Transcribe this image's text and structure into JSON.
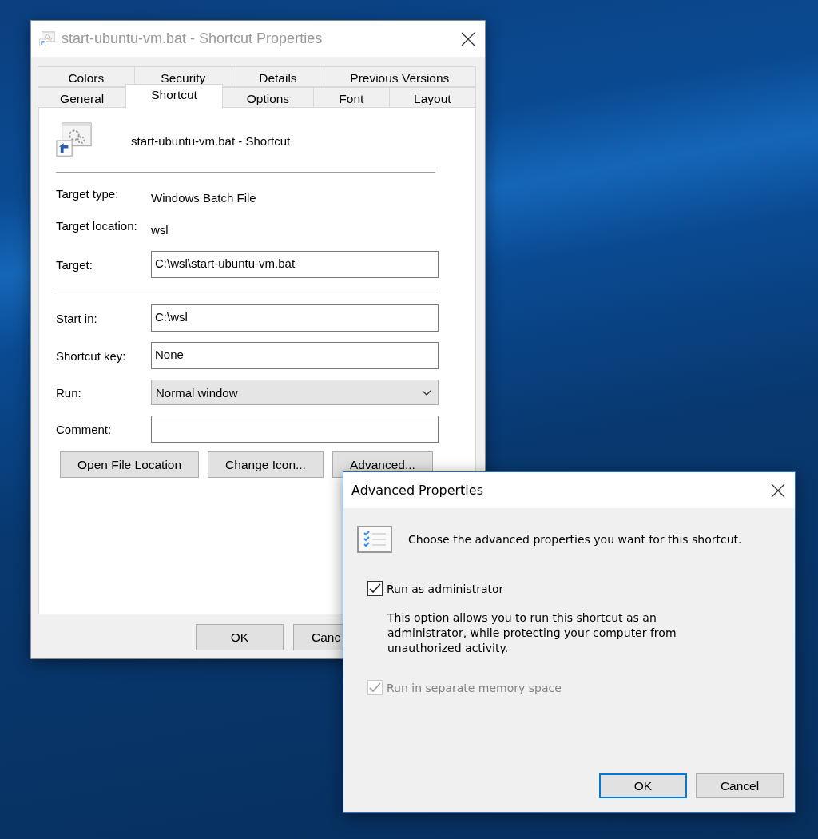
{
  "properties_window": {
    "title": "start-ubuntu-vm.bat - Shortcut Properties",
    "tab_rows": [
      [
        {
          "label": "Colors",
          "selected": false
        },
        {
          "label": "Security",
          "selected": false
        },
        {
          "label": "Details",
          "selected": false
        },
        {
          "label": "Previous Versions",
          "selected": false
        }
      ],
      [
        {
          "label": "General",
          "selected": false
        },
        {
          "label": "Shortcut",
          "selected": true
        },
        {
          "label": "Options",
          "selected": false
        },
        {
          "label": "Font",
          "selected": false
        },
        {
          "label": "Layout",
          "selected": false
        }
      ]
    ],
    "shortcut_name": "start-ubuntu-vm.bat - Shortcut",
    "field_groups": [
      [
        {
          "kind": "text",
          "label": "Target type:",
          "value": "Windows Batch File"
        },
        {
          "kind": "text",
          "label": "Target location:",
          "value": "wsl"
        },
        {
          "kind": "input",
          "label": "Target:",
          "value": "C:\\wsl\\start-ubuntu-vm.bat"
        }
      ],
      [
        {
          "kind": "input",
          "label": "Start in:",
          "value": "C:\\wsl"
        },
        {
          "kind": "input",
          "label": "Shortcut key:",
          "value": "None"
        },
        {
          "kind": "select",
          "label": "Run:",
          "value": "Normal window"
        },
        {
          "kind": "input",
          "label": "Comment:"
        }
      ]
    ],
    "action_buttons": [
      "Open File Location",
      "Change Icon...",
      "Advanced..."
    ],
    "footer_buttons": [
      {
        "label": "OK",
        "clipped": false
      },
      {
        "label": "Canc",
        "clipped": true
      }
    ]
  },
  "advanced_dialog": {
    "title": "Advanced Properties",
    "intro": "Choose the advanced properties you want for this shortcut.",
    "options": [
      {
        "label": "Run as administrator",
        "checked": true,
        "disabled": false,
        "description": "This option allows you to run this shortcut as an administrator, while protecting your computer from unauthorized activity."
      },
      {
        "label": "Run in separate memory space",
        "checked": true,
        "disabled": true
      }
    ],
    "buttons": [
      {
        "label": "OK",
        "default": true
      },
      {
        "label": "Cancel",
        "default": false
      }
    ]
  }
}
